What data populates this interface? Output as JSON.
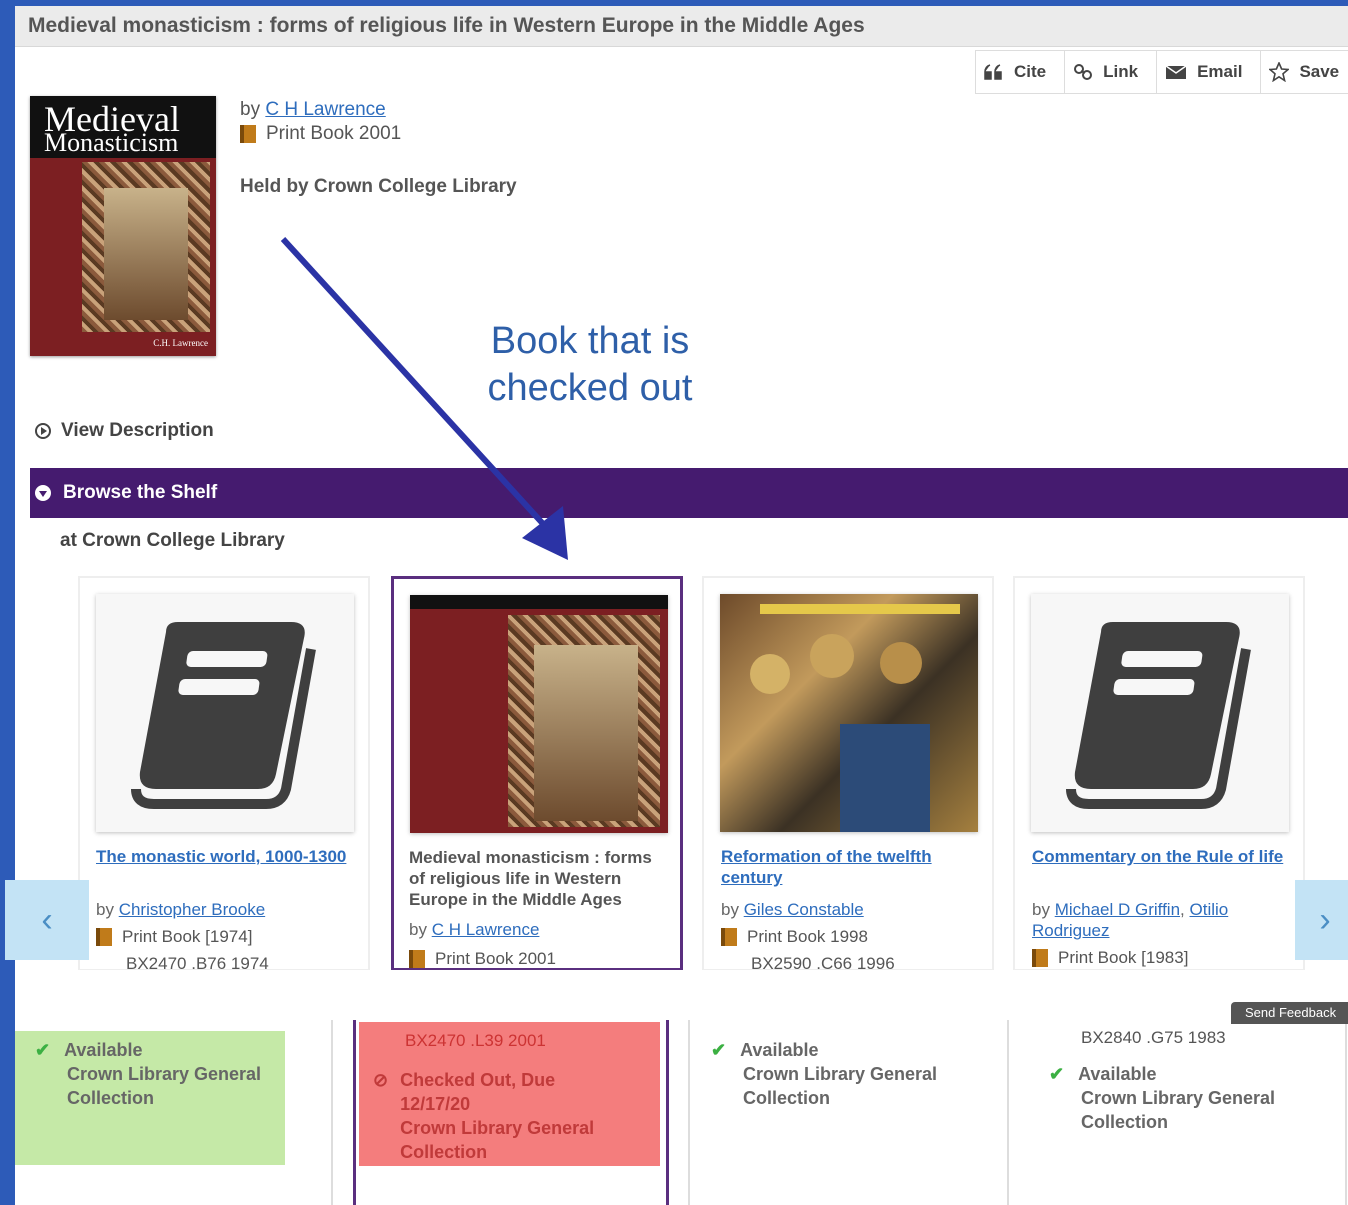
{
  "title": "Medieval monasticism : forms of religious life in Western Europe in the Middle Ages",
  "actions": [
    {
      "label": "Cite",
      "icon": "quote-icon"
    },
    {
      "label": "Link",
      "icon": "link-icon"
    },
    {
      "label": "Email",
      "icon": "envelope-icon"
    },
    {
      "label": "Save",
      "icon": "star-icon"
    }
  ],
  "record": {
    "cover_title_line1": "Medieval",
    "cover_title_line2": "Monasticism",
    "cover_author": "C.H. Lawrence",
    "by": "by",
    "author": "C H Lawrence",
    "format": "Print Book 2001",
    "held_by": "Held by Crown College Library"
  },
  "annotation": {
    "line1": "Book that is",
    "line2": "checked out"
  },
  "view_description": "View Description",
  "browse": {
    "title": "Browse the Shelf",
    "location": "at Crown College Library"
  },
  "cards": [
    {
      "title": "The monastic world, 1000-1300",
      "by": "by",
      "authors": [
        "Christopher Brooke"
      ],
      "format": "Print Book [1974]",
      "call": "BX2470 .B76 1974",
      "status": "Available",
      "location": "Crown Library General Collection"
    },
    {
      "title": "Medieval monasticism : forms of religious life in Western Europe in the Middle Ages",
      "by": "by",
      "authors": [
        "C H Lawrence"
      ],
      "format": "Print Book 2001",
      "call": "BX2470 .L39 2001",
      "status": "Checked Out, Due 12/17/20",
      "location": "Crown Library General Collection"
    },
    {
      "title": "Reformation of the twelfth century",
      "by": "by",
      "authors": [
        "Giles Constable"
      ],
      "format": "Print Book 1998",
      "call": "BX2590 .C66 1996",
      "status": "Available",
      "location": "Crown Library General Collection"
    },
    {
      "title": "Commentary on the Rule of life",
      "by": "by",
      "authors": [
        "Michael D Griffin",
        "Otilio Rodriguez"
      ],
      "format": "Print Book [1983]",
      "call": "BX2840 .G75 1983",
      "status": "Available",
      "location": "Crown Library General Collection"
    }
  ],
  "feedback": "Send Feedback",
  "colors": {
    "browse_bar": "#451b6f",
    "available_bg": "#c5e9a7",
    "checked_out_bg": "#f47d7d",
    "link": "#2e6dbd",
    "annotation": "#2e5fa8"
  }
}
